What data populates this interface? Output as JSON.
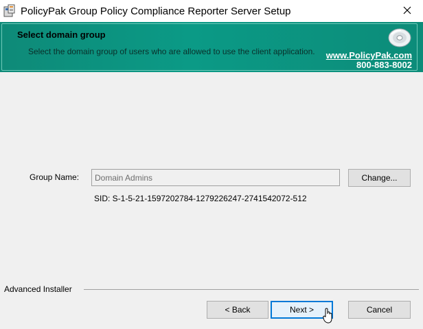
{
  "window": {
    "title": "PolicyPak Group Policy Compliance Reporter Server Setup",
    "icon": "installer-icon",
    "close_icon": "close-icon"
  },
  "banner": {
    "heading": "Select domain group",
    "description": "Select the domain group of users who are allowed to use the client application.",
    "brand_url": "www.PolicyPak.com",
    "brand_phone": "800-883-8002",
    "icon": "cd-icon",
    "colors": {
      "teal": "#0e8a78",
      "text_white": "#ffffff"
    }
  },
  "form": {
    "group_name_label": "Group Name:",
    "group_name_value": "Domain Admins",
    "change_button": "Change...",
    "sid_text": "SID: S-1-5-21-1597202784-1279226247-2741542072-512"
  },
  "footer": {
    "installer_label": "Advanced Installer",
    "back_button": "< Back",
    "next_button": "Next >",
    "cancel_button": "Cancel"
  }
}
